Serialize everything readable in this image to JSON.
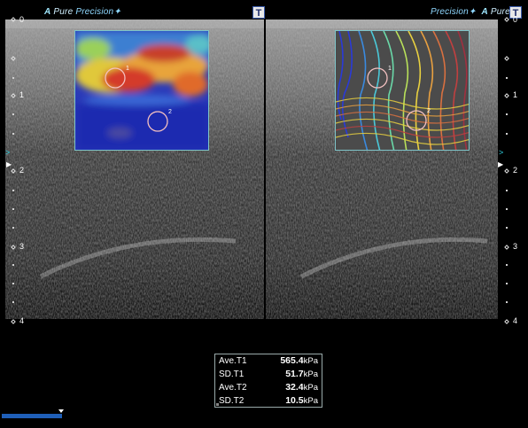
{
  "header": {
    "left_brand": {
      "a": "A",
      "pure": "Pure",
      "precision": "Precision✦"
    },
    "right_brand": {
      "precision": "Precision✦",
      "a": "A",
      "pure": "Pure"
    },
    "tool_label": "T"
  },
  "depth_scale": {
    "labels": [
      "0",
      "1",
      "2",
      "3",
      "4"
    ]
  },
  "rois": {
    "left_label_1": "1",
    "left_label_2": "2",
    "right_label_1": "1",
    "right_label_2": "2"
  },
  "measurements": [
    {
      "label": "Ave.T1",
      "value": "565.4",
      "unit": "kPa"
    },
    {
      "label": "SD.T1",
      "value": "51.7",
      "unit": "kPa"
    },
    {
      "label": "Ave.T2",
      "value": "32.4",
      "unit": "kPa"
    },
    {
      "label": "SD.T2",
      "value": "10.5",
      "unit": "kPa"
    }
  ],
  "colors": {
    "accent": "#1f5fb8",
    "roi_border": "#7fc4c8",
    "background": "#000000"
  },
  "icons": [
    "tool-t-icon",
    "depth-marker-icon",
    "focus-arrow-icon",
    "roi-circle-icon"
  ]
}
